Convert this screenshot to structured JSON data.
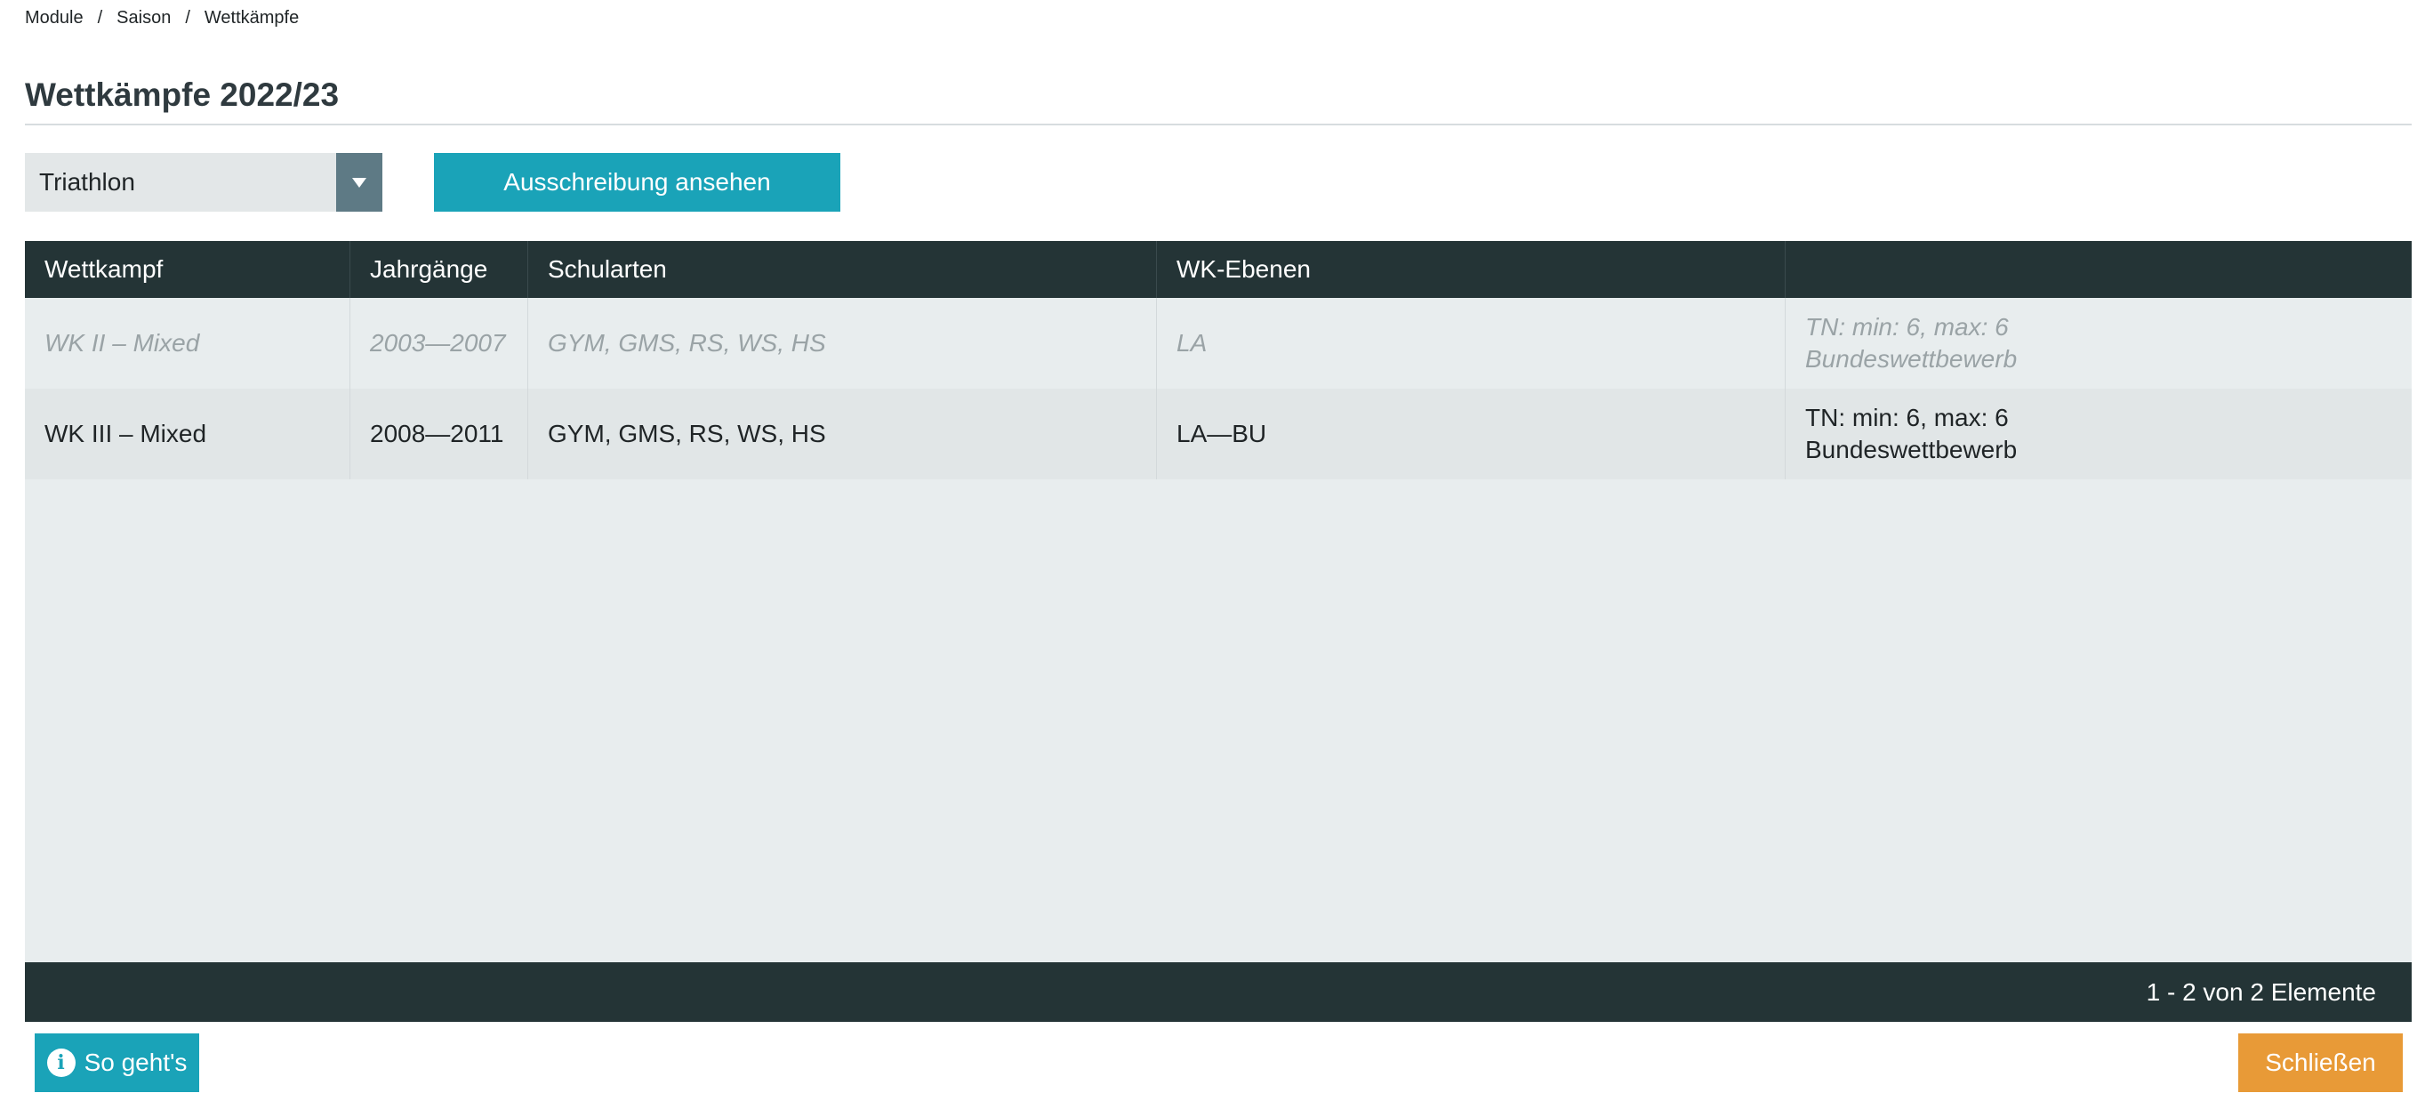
{
  "breadcrumb": {
    "items": [
      "Module",
      "Saison",
      "Wettkämpfe"
    ],
    "separator": "/"
  },
  "page": {
    "title": "Wettkämpfe 2022/23"
  },
  "filter": {
    "selected": "Triathlon"
  },
  "toolbar": {
    "view_tender_label": "Ausschreibung ansehen"
  },
  "table": {
    "columns": [
      "Wettkampf",
      "Jahrgänge",
      "Schularten",
      "WK-Ebenen",
      ""
    ],
    "rows": [
      {
        "wettkampf": "WK II – Mixed",
        "jahrgaenge": "2003—2007",
        "schularten": "GYM, GMS, RS, WS, HS",
        "ebenen": "LA",
        "info_line1": "TN: min: 6, max: 6",
        "info_line2": "Bundeswettbewerb",
        "disabled": true
      },
      {
        "wettkampf": "WK III – Mixed",
        "jahrgaenge": "2008—2011",
        "schularten": "GYM, GMS, RS, WS, HS",
        "ebenen": "LA—BU",
        "info_line1": "TN: min: 6, max: 6",
        "info_line2": "Bundeswettbewerb",
        "disabled": false
      }
    ],
    "pager_text": "1 - 2 von 2 Elemente"
  },
  "footer": {
    "help_label": "So geht's",
    "close_label": "Schließen"
  },
  "icons": {
    "help": "info-icon",
    "dropdown": "caret-down-icon"
  },
  "colors": {
    "teal": "#1aa3b8",
    "dark": "#243436",
    "orange": "#e89a37",
    "grid_bg": "#e8edee"
  }
}
